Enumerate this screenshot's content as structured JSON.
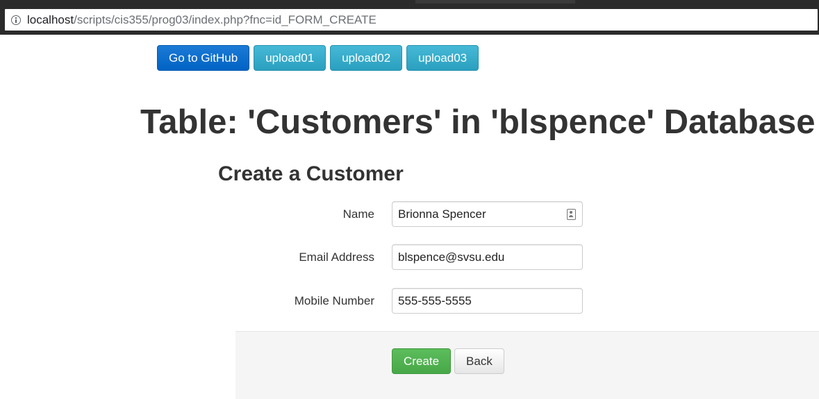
{
  "browser": {
    "url_host": "localhost",
    "url_path": "/scripts/cis355/prog03/index.php?fnc=id_FORM_CREATE"
  },
  "nav": {
    "buttons": [
      {
        "label": "Go to GitHub",
        "style": "primary"
      },
      {
        "label": "upload01",
        "style": "info"
      },
      {
        "label": "upload02",
        "style": "info"
      },
      {
        "label": "upload03",
        "style": "info"
      }
    ]
  },
  "page": {
    "title": "Table: 'Customers' in 'blspence' Database"
  },
  "form": {
    "title": "Create a Customer",
    "fields": [
      {
        "label": "Name",
        "value": "Brionna Spencer",
        "placeholder": ""
      },
      {
        "label": "Email Address",
        "value": "blspence@svsu.edu",
        "placeholder": ""
      },
      {
        "label": "Mobile Number",
        "value": "555-555-5555",
        "placeholder": ""
      }
    ],
    "create_label": "Create",
    "back_label": "Back"
  },
  "colors": {
    "primary": "#0063c4",
    "info": "#31a6c6",
    "success": "#4cae4c",
    "text": "#333333"
  }
}
